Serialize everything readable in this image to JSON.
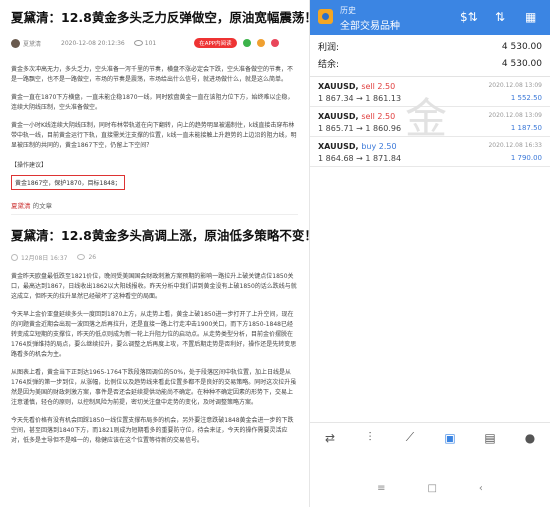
{
  "article": {
    "title": "夏黛清：12.8黄金多头乏力反弹做空，原油宽幅震荡！",
    "author": "夏黛清",
    "datetime": "2020-12-08 20:12:36",
    "views": "101",
    "app_button": "在APP内阅读",
    "paragraphs": [
      "黄金多次冲高无力，多头乏力，空头准备一泻千里的节奏，横盘不涨必定会下跌，空头准备做空的节奏，不是一路飘空，也不是一路做空，市场的节奏是震荡，市场给出什么信号，就进场做什么，就是这么简单。",
      "黄金一直在1870下方横盘，一直未能企稳1870一线，同时欧盘黄金一直在该阻力位下方，始终难以企稳，连续大阴线压制，空头准备做空。",
      "黄金一小时K线连续大阴线压制，同时布林带轨道在向下翻转，向上的趋势明显被遏制住，k线直接击穿布林带中轨一线，目前黄金运行下轨，直接需关注支撑的位置，k线一直未能接触上升趋势的上边沿的阻力线，明显被压制的共同的，黄金1867下空，仍留上下空间？"
    ],
    "tip_label": "【操作建议】",
    "callout": "黄金1867空，保护1870，目标1848；",
    "author_line_name": "夏黛清",
    "author_line_tail": "的文章"
  },
  "article2": {
    "title": "夏黛清：12.8黄金多头高调上涨，原油低多策略不变！",
    "date": "12月08日 16:37",
    "views": "26",
    "paragraphs": [
      "黄金昨天欧盘最低跌至1821价位，晚间受美国国会财政刺激方案预期的影响一路拉升上破关键点位1850关口，最高达到1867，日线收出1862以大阳线报收。昨天分析中我们讲到黄金没有上破1850的话么跌线与就这成立，但昨天的拉升显然已经破坏了这种看空的局面。",
      "今天早上金价亚盘延续多头一度回到1870上方，从走势上看，黄金上破1850进一步打开了上升空间，现在的问题黄金近期会出现一波回落之后再拉升，还是直接一路上行走冲击1900关口，而下方1850-1848已经转变成立短期的支撑位，昨天的低点则成为新一轮上升阻力位的启动点。从走势类型分析，目前金价摆脱在1764反弹维持的局点，要么继续拉升，要么调整之后再度上攻，不置后期走势是否利好，操作还是先转变思路看多的机会为主。",
      "从图表上看，黄金当下正到达1965-1764下跌段落回调位的50%，处于段落区间中轨位置，加上日线是从1764反弹的第一步到位，从涨幅，比例位以及趋势线来看此位置多都不是良好的交易策略。同时这次拉升虽然是因为美国的财政刺激方案，事件是否还会延续提供动能尚不确定。在种种不确定因素的形势下，交易上注意谨慎，轻仓的原则，以控制风险为前提，密切关注盘中走势的变化，及时调整策略方案。",
      "今天先看价格有没有机会回踩1850一线位置支撑布局多的机会，另外要注意跌破1848黄金会进一步的下跌空间，甚至回落到1840下方，而1821则成为短期看多的重要防守位，待会来证，今天的操作需要灵活应对，低多是主导但不是唯一的，稳健应该在这个位置等待新的交易信号。"
    ]
  },
  "terminal": {
    "history_label": "历史",
    "title": "全部交易品种",
    "profit_label": "利润:",
    "profit_value": "4 530.00",
    "balance_label": "结余:",
    "balance_value": "4 530.00",
    "watermark": "金",
    "trades": [
      {
        "symbol": "XAUUSD,",
        "side": "sell 2.50",
        "side_type": "sell",
        "prices": "1 867.34 → 1 861.13",
        "time": "2020.12.08 13:09",
        "pl": "1 552.50"
      },
      {
        "symbol": "XAUUSD,",
        "side": "sell 2.50",
        "side_type": "sell",
        "prices": "1 865.71 → 1 860.96",
        "time": "2020.12.08 13:09",
        "pl": "1 187.50"
      },
      {
        "symbol": "XAUUSD,",
        "side": "buy 2.50",
        "side_type": "buy",
        "prices": "1 864.68 → 1 871.84",
        "time": "2020.12.08 16:33",
        "pl": "1 790.00"
      }
    ],
    "bottom_icons": [
      "quotes-icon",
      "chart-icon",
      "trade-icon",
      "history-icon",
      "messages-icon",
      "chat-icon"
    ],
    "accent_color": "#3b85e3"
  }
}
